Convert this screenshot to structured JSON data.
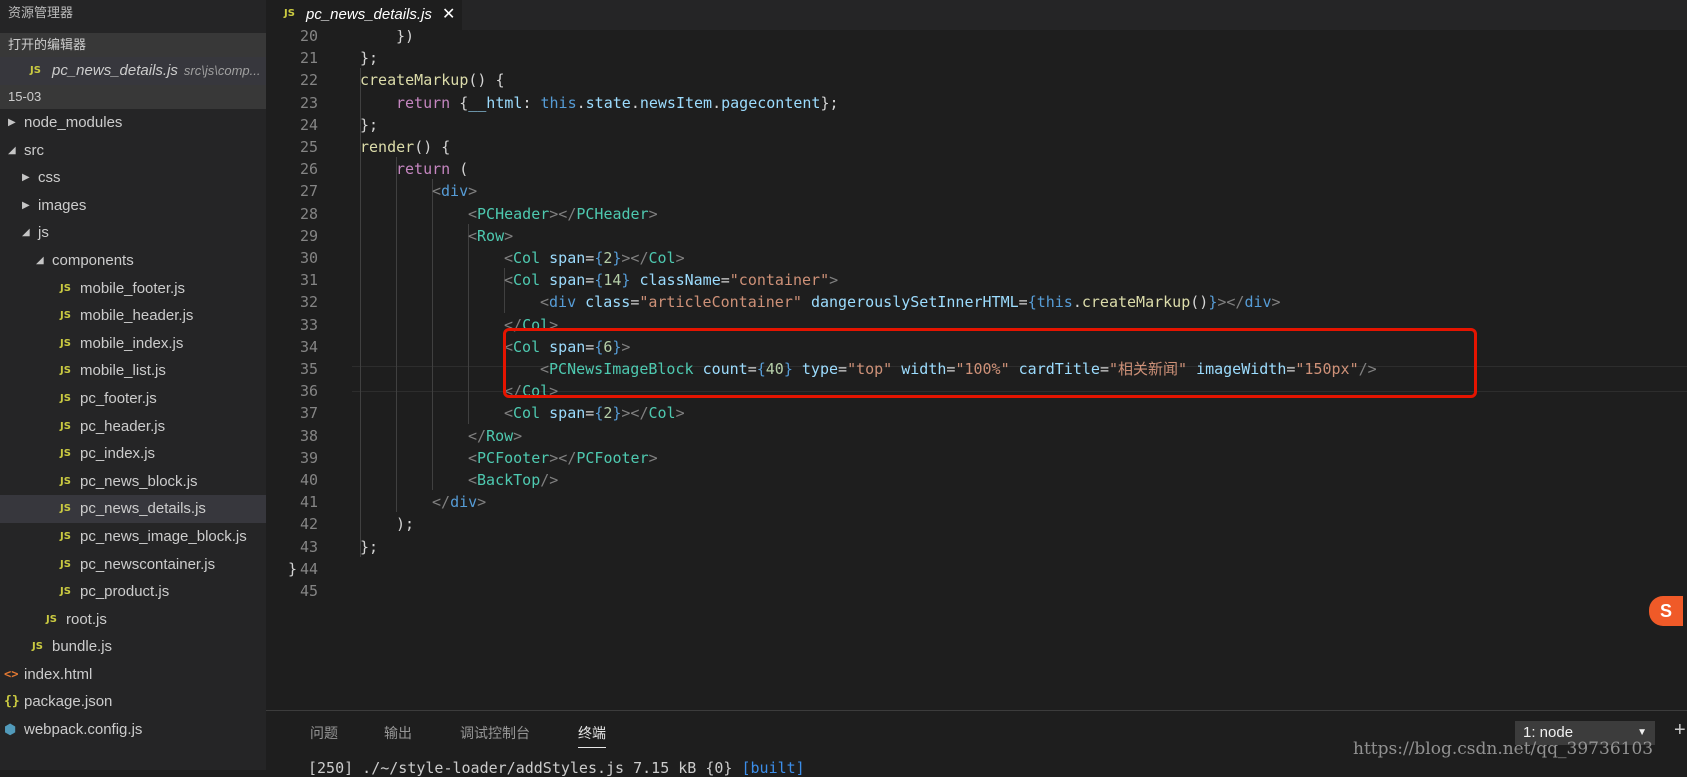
{
  "sidebar": {
    "title": "资源管理器",
    "open_editors_header": "打开的编辑器",
    "open_file": {
      "icon": "JS",
      "name": "pc_news_details.js",
      "path": "src\\js\\comp..."
    },
    "folder_header": "15-03",
    "tree": [
      {
        "label": "node_modules",
        "type": "folder",
        "expanded": false,
        "depth": 0
      },
      {
        "label": "src",
        "type": "folder",
        "expanded": true,
        "depth": 0
      },
      {
        "label": "css",
        "type": "folder",
        "expanded": false,
        "depth": 1
      },
      {
        "label": "images",
        "type": "folder",
        "expanded": false,
        "depth": 1
      },
      {
        "label": "js",
        "type": "folder",
        "expanded": true,
        "depth": 1
      },
      {
        "label": "components",
        "type": "folder",
        "expanded": true,
        "depth": 2
      },
      {
        "label": "mobile_footer.js",
        "type": "js",
        "depth": 3
      },
      {
        "label": "mobile_header.js",
        "type": "js",
        "depth": 3
      },
      {
        "label": "mobile_index.js",
        "type": "js",
        "depth": 3
      },
      {
        "label": "mobile_list.js",
        "type": "js",
        "depth": 3
      },
      {
        "label": "pc_footer.js",
        "type": "js",
        "depth": 3
      },
      {
        "label": "pc_header.js",
        "type": "js",
        "depth": 3
      },
      {
        "label": "pc_index.js",
        "type": "js",
        "depth": 3
      },
      {
        "label": "pc_news_block.js",
        "type": "js",
        "depth": 3
      },
      {
        "label": "pc_news_details.js",
        "type": "js",
        "depth": 3,
        "selected": true
      },
      {
        "label": "pc_news_image_block.js",
        "type": "js",
        "depth": 3
      },
      {
        "label": "pc_newscontainer.js",
        "type": "js",
        "depth": 3
      },
      {
        "label": "pc_product.js",
        "type": "js",
        "depth": 3
      },
      {
        "label": "root.js",
        "type": "js",
        "depth": 2
      },
      {
        "label": "bundle.js",
        "type": "js",
        "depth": 1
      },
      {
        "label": "index.html",
        "type": "html",
        "depth": 0
      },
      {
        "label": "package.json",
        "type": "json",
        "depth": 0
      },
      {
        "label": "webpack.config.js",
        "type": "webpack",
        "depth": 0
      }
    ]
  },
  "icons": {
    "js": "JS",
    "html": "<>",
    "json": "{}",
    "webpack": "⬢",
    "caret_right": "▶",
    "caret_down": "◢",
    "close": "✕"
  },
  "tab": {
    "icon": "JS",
    "title": "pc_news_details.js",
    "close": "✕"
  },
  "editor": {
    "first_line": 20,
    "lines": [
      {
        "n": "20",
        "indent": 3,
        "tokens": [
          [
            "p",
            "})"
          ]
        ]
      },
      {
        "n": "21",
        "indent": 2,
        "tokens": [
          [
            "p",
            "};"
          ]
        ]
      },
      {
        "n": "22",
        "indent": 2,
        "tokens": [
          [
            "fn",
            "createMarkup"
          ],
          [
            "p",
            "() {"
          ]
        ]
      },
      {
        "n": "23",
        "indent": 3,
        "tokens": [
          [
            "kw",
            "return"
          ],
          [
            "p",
            " {"
          ],
          [
            "attr",
            "__html"
          ],
          [
            "p",
            ": "
          ],
          [
            "this",
            "this"
          ],
          [
            "p",
            "."
          ],
          [
            "prop",
            "state"
          ],
          [
            "p",
            "."
          ],
          [
            "prop",
            "newsItem"
          ],
          [
            "p",
            "."
          ],
          [
            "prop",
            "pagecontent"
          ],
          [
            "p",
            "};"
          ]
        ]
      },
      {
        "n": "24",
        "indent": 2,
        "tokens": [
          [
            "p",
            "};"
          ]
        ]
      },
      {
        "n": "25",
        "indent": 2,
        "tokens": [
          [
            "fn",
            "render"
          ],
          [
            "p",
            "() {"
          ]
        ]
      },
      {
        "n": "26",
        "indent": 3,
        "tokens": [
          [
            "kw",
            "return"
          ],
          [
            "p",
            " ("
          ]
        ]
      },
      {
        "n": "27",
        "indent": 4,
        "tokens": [
          [
            "br",
            "<"
          ],
          [
            "this",
            "div"
          ],
          [
            "br",
            ">"
          ]
        ]
      },
      {
        "n": "28",
        "indent": 5,
        "tokens": [
          [
            "br",
            "<"
          ],
          [
            "tag",
            "PCHeader"
          ],
          [
            "br",
            "></"
          ],
          [
            "tag",
            "PCHeader"
          ],
          [
            "br",
            ">"
          ]
        ]
      },
      {
        "n": "29",
        "indent": 5,
        "tokens": [
          [
            "br",
            "<"
          ],
          [
            "tag",
            "Row"
          ],
          [
            "br",
            ">"
          ]
        ]
      },
      {
        "n": "30",
        "indent": 6,
        "tokens": [
          [
            "br",
            "<"
          ],
          [
            "tag",
            "Col"
          ],
          [
            "p",
            " "
          ],
          [
            "attr",
            "span"
          ],
          [
            "p",
            "="
          ],
          [
            "this",
            "{"
          ],
          [
            "num",
            "2"
          ],
          [
            "this",
            "}"
          ],
          [
            "br",
            "></"
          ],
          [
            "tag",
            "Col"
          ],
          [
            "br",
            ">"
          ]
        ]
      },
      {
        "n": "31",
        "indent": 6,
        "tokens": [
          [
            "br",
            "<"
          ],
          [
            "tag",
            "Col"
          ],
          [
            "p",
            " "
          ],
          [
            "attr",
            "span"
          ],
          [
            "p",
            "="
          ],
          [
            "this",
            "{"
          ],
          [
            "num",
            "14"
          ],
          [
            "this",
            "}"
          ],
          [
            "p",
            " "
          ],
          [
            "attr",
            "className"
          ],
          [
            "p",
            "="
          ],
          [
            "str",
            "\"container\""
          ],
          [
            "br",
            ">"
          ]
        ]
      },
      {
        "n": "32",
        "indent": 7,
        "tokens": [
          [
            "br",
            "<"
          ],
          [
            "this",
            "div"
          ],
          [
            "p",
            " "
          ],
          [
            "attr",
            "class"
          ],
          [
            "p",
            "="
          ],
          [
            "str",
            "\"articleContainer\""
          ],
          [
            "p",
            " "
          ],
          [
            "attr",
            "dangerouslySetInnerHTML"
          ],
          [
            "p",
            "="
          ],
          [
            "this",
            "{"
          ],
          [
            "this",
            "this"
          ],
          [
            "p",
            "."
          ],
          [
            "fn",
            "createMarkup"
          ],
          [
            "p",
            "()"
          ],
          [
            "this",
            "}"
          ],
          [
            "br",
            "></"
          ],
          [
            "this",
            "div"
          ],
          [
            "br",
            ">"
          ]
        ]
      },
      {
        "n": "33",
        "indent": 6,
        "tokens": [
          [
            "br",
            "</"
          ],
          [
            "tag",
            "Col"
          ],
          [
            "br",
            ">"
          ]
        ]
      },
      {
        "n": "34",
        "indent": 6,
        "tokens": [
          [
            "br",
            "<"
          ],
          [
            "tag",
            "Col"
          ],
          [
            "p",
            " "
          ],
          [
            "attr",
            "span"
          ],
          [
            "p",
            "="
          ],
          [
            "this",
            "{"
          ],
          [
            "num",
            "6"
          ],
          [
            "this",
            "}"
          ],
          [
            "br",
            ">"
          ]
        ]
      },
      {
        "n": "35",
        "indent": 7,
        "tokens": [
          [
            "br",
            "<"
          ],
          [
            "tag",
            "PCNewsImageBlock"
          ],
          [
            "p",
            " "
          ],
          [
            "attr",
            "count"
          ],
          [
            "p",
            "="
          ],
          [
            "this",
            "{"
          ],
          [
            "num",
            "40"
          ],
          [
            "this",
            "}"
          ],
          [
            "p",
            " "
          ],
          [
            "attr",
            "type"
          ],
          [
            "p",
            "="
          ],
          [
            "str",
            "\"top\""
          ],
          [
            "p",
            " "
          ],
          [
            "attr",
            "width"
          ],
          [
            "p",
            "="
          ],
          [
            "str",
            "\"100%\""
          ],
          [
            "p",
            " "
          ],
          [
            "attr",
            "cardTitle"
          ],
          [
            "p",
            "="
          ],
          [
            "str",
            "\"相关新闻\""
          ],
          [
            "p",
            " "
          ],
          [
            "attr",
            "imageWidth"
          ],
          [
            "p",
            "="
          ],
          [
            "str",
            "\"150px\""
          ],
          [
            "br",
            "/>"
          ]
        ]
      },
      {
        "n": "36",
        "indent": 6,
        "tokens": [
          [
            "br",
            "</"
          ],
          [
            "tag",
            "Col"
          ],
          [
            "br",
            ">"
          ]
        ]
      },
      {
        "n": "37",
        "indent": 6,
        "tokens": [
          [
            "br",
            "<"
          ],
          [
            "tag",
            "Col"
          ],
          [
            "p",
            " "
          ],
          [
            "attr",
            "span"
          ],
          [
            "p",
            "="
          ],
          [
            "this",
            "{"
          ],
          [
            "num",
            "2"
          ],
          [
            "this",
            "}"
          ],
          [
            "br",
            "></"
          ],
          [
            "tag",
            "Col"
          ],
          [
            "br",
            ">"
          ]
        ]
      },
      {
        "n": "38",
        "indent": 5,
        "tokens": [
          [
            "br",
            "</"
          ],
          [
            "tag",
            "Row"
          ],
          [
            "br",
            ">"
          ]
        ]
      },
      {
        "n": "39",
        "indent": 5,
        "tokens": [
          [
            "br",
            "<"
          ],
          [
            "tag",
            "PCFooter"
          ],
          [
            "br",
            "></"
          ],
          [
            "tag",
            "PCFooter"
          ],
          [
            "br",
            ">"
          ]
        ]
      },
      {
        "n": "40",
        "indent": 5,
        "tokens": [
          [
            "br",
            "<"
          ],
          [
            "tag",
            "BackTop"
          ],
          [
            "br",
            "/>"
          ]
        ]
      },
      {
        "n": "41",
        "indent": 4,
        "tokens": [
          [
            "br",
            "</"
          ],
          [
            "this",
            "div"
          ],
          [
            "br",
            ">"
          ]
        ]
      },
      {
        "n": "42",
        "indent": 3,
        "tokens": [
          [
            "p",
            ");"
          ]
        ]
      },
      {
        "n": "43",
        "indent": 2,
        "tokens": [
          [
            "p",
            "};"
          ]
        ]
      },
      {
        "n": "44",
        "indent": 0,
        "tokens": [
          [
            "p",
            "}"
          ]
        ]
      },
      {
        "n": "45",
        "indent": 0,
        "tokens": []
      }
    ],
    "ime_badge": "S"
  },
  "panel": {
    "tabs": [
      "问题",
      "输出",
      "调试控制台",
      "终端"
    ],
    "active_tab": "终端",
    "terminal_select": "1: node",
    "dropdown_glyph": "▼",
    "add_glyph": "+",
    "terminal_line_prefix": "[250] ./~/style-loader/addStyles.js 7.15 kB {0} ",
    "terminal_line_built": "[built]",
    "watermark": "https://blog.csdn.net/qq_39736103"
  },
  "colors": {
    "editor_bg": "#1e1e1e",
    "sidebar_bg": "#252526",
    "highlight_box": "#e51400",
    "js_icon": "#cbcb41"
  }
}
